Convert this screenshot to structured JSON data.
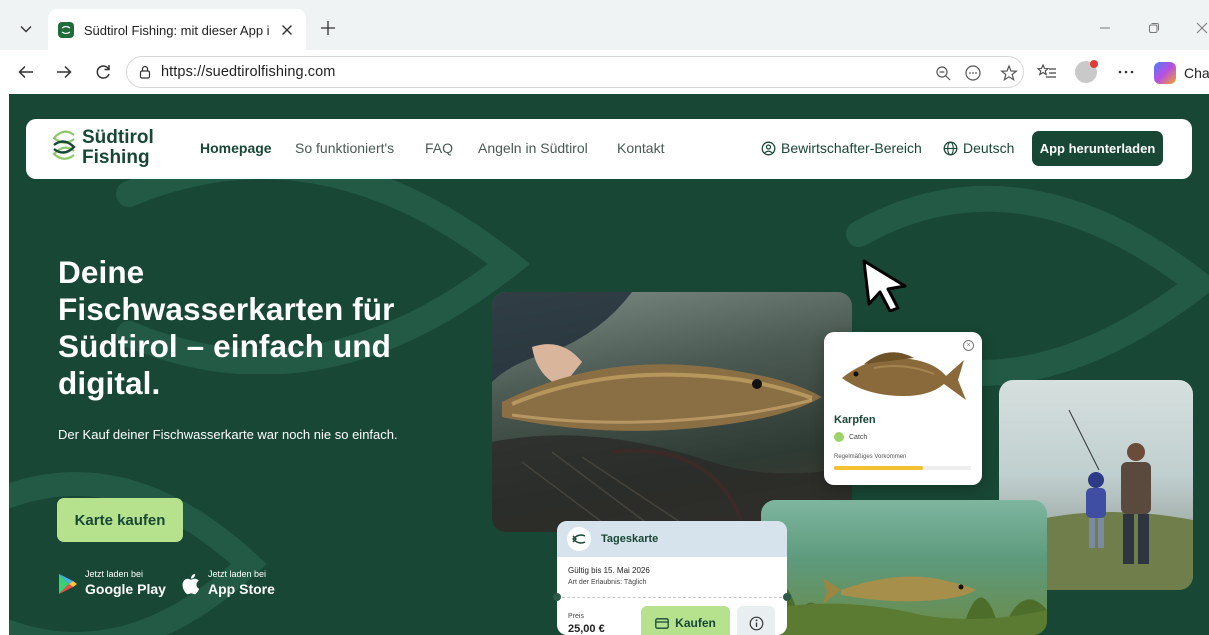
{
  "browser": {
    "tab_title": "Südtirol Fishing: mit dieser App in",
    "url": "https://suedtirolfishing.com",
    "copilot_label": "Cha"
  },
  "site": {
    "brand_line1": "Südtirol",
    "brand_line2": "Fishing",
    "nav": [
      "Homepage",
      "So funktioniert's",
      "FAQ",
      "Angeln in Südtirol",
      "Kontakt"
    ],
    "manager_area": "Bewirtschafter-Bereich",
    "language": "Deutsch",
    "download_button": "App herunterladen",
    "colors": {
      "primary": "#184735",
      "accent": "#b6e28d"
    }
  },
  "hero": {
    "title": "Deine Fischwasserkarten für Südtirol – einfach und digital.",
    "subtitle": "Der Kauf deiner Fischwasserkarte war noch nie so einfach.",
    "cta": "Karte kaufen",
    "google_small": "Jetzt laden bei",
    "google_big": "Google Play",
    "apple_small": "Jetzt laden bei",
    "apple_big": "App Store"
  },
  "carp_card": {
    "name": "Karpfen",
    "tag": "Catch",
    "occurrence": "Regelmäßiges Vorkommen",
    "occurrence_level": 0.65
  },
  "ticket": {
    "title": "Tageskarte",
    "valid_until": "Gültig bis 15. Mai 2026",
    "permit_type": "Art der Erlaubnis: Täglich",
    "price_label": "Preis",
    "price": "25,00 €",
    "buy": "Kaufen"
  }
}
